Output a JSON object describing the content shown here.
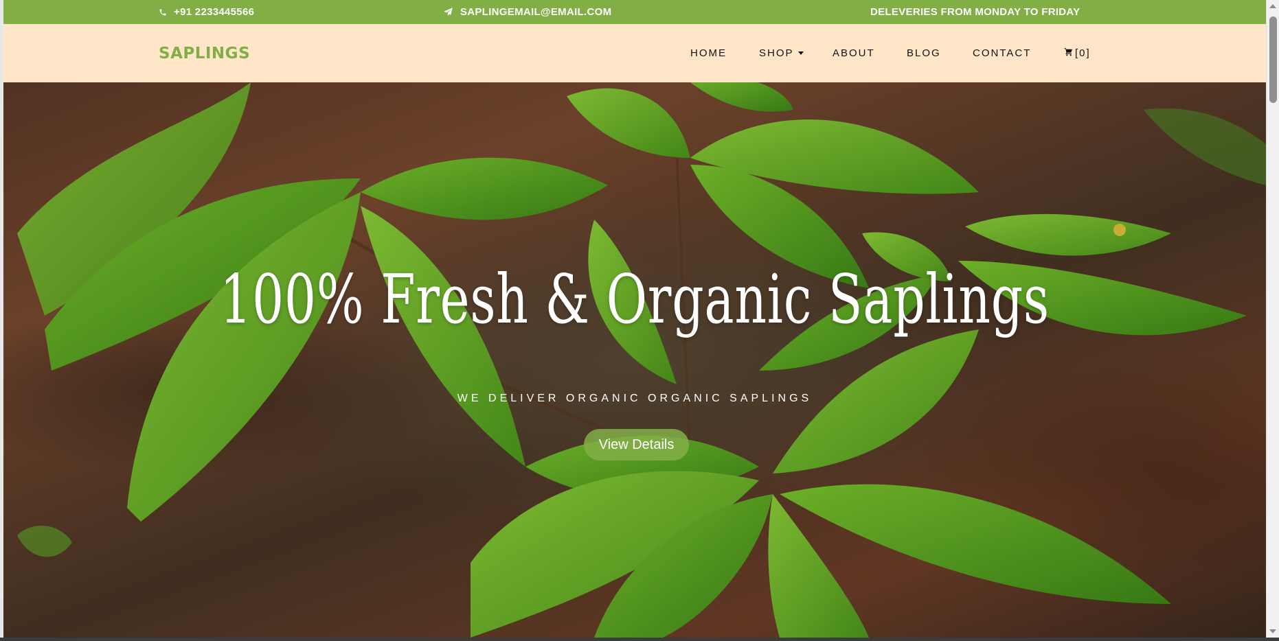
{
  "topbar": {
    "phone": "+91 2233445566",
    "phone_icon": "phone-icon",
    "email": "SAPLINGEMAIL@EMAIL.COM",
    "email_icon": "paper-plane-icon",
    "delivery": "DELEVERIES FROM MONDAY TO FRIDAY"
  },
  "navbar": {
    "brand": "SAPLINGS",
    "items": [
      {
        "label": "HOME"
      },
      {
        "label": "SHOP"
      },
      {
        "label": "ABOUT"
      },
      {
        "label": "BLOG"
      },
      {
        "label": "CONTACT"
      }
    ],
    "cart_icon": "cart-icon",
    "cart_count": "[0]"
  },
  "hero": {
    "title": "100% Fresh & Organic Saplings",
    "subtitle": "WE DELIVER ORGANIC ORGANIC SAPLINGS",
    "button": "View Details"
  },
  "colors": {
    "accent": "#82ae46",
    "navbar_bg": "#ffe6c8"
  }
}
